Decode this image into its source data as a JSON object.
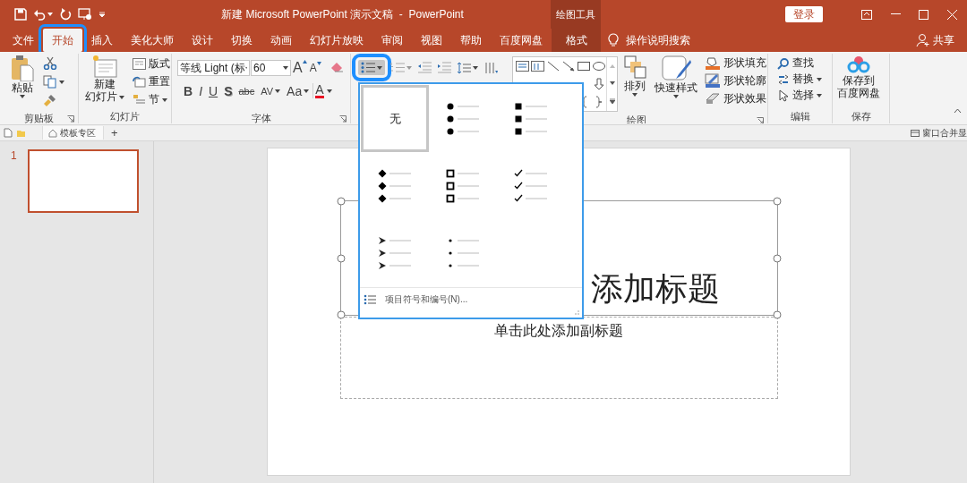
{
  "window": {
    "title": "新建 Microsoft PowerPoint 演示文稿  -  PowerPoint",
    "context_header": "绘图工具",
    "login": "登录"
  },
  "tabs": [
    {
      "label": "文件",
      "selected": false,
      "highlighted": false,
      "kind": "normal"
    },
    {
      "label": "开始",
      "selected": true,
      "highlighted": true,
      "kind": "normal"
    },
    {
      "label": "插入",
      "selected": false,
      "highlighted": false,
      "kind": "normal"
    },
    {
      "label": "美化大师",
      "selected": false,
      "highlighted": false,
      "kind": "normal"
    },
    {
      "label": "设计",
      "selected": false,
      "highlighted": false,
      "kind": "normal"
    },
    {
      "label": "切换",
      "selected": false,
      "highlighted": false,
      "kind": "normal"
    },
    {
      "label": "动画",
      "selected": false,
      "highlighted": false,
      "kind": "normal"
    },
    {
      "label": "幻灯片放映",
      "selected": false,
      "highlighted": false,
      "kind": "normal"
    },
    {
      "label": "审阅",
      "selected": false,
      "highlighted": false,
      "kind": "normal"
    },
    {
      "label": "视图",
      "selected": false,
      "highlighted": false,
      "kind": "normal"
    },
    {
      "label": "帮助",
      "selected": false,
      "highlighted": false,
      "kind": "normal"
    },
    {
      "label": "百度网盘",
      "selected": false,
      "highlighted": false,
      "kind": "normal"
    },
    {
      "label": "格式",
      "selected": false,
      "highlighted": false,
      "kind": "contextual"
    }
  ],
  "tell_me": "操作说明搜索",
  "share": "共享",
  "ribbon": {
    "clipboard": {
      "paste": "粘贴",
      "label": "剪贴板"
    },
    "slides": {
      "new_slide": [
        "新建",
        "幻灯片"
      ],
      "layout": "版式",
      "reset": "重置",
      "section": "节",
      "label": "幻灯片"
    },
    "font": {
      "name": "等线 Light (标",
      "size": "60",
      "grow": "A",
      "shrink": "A",
      "color_button": "A",
      "label": "字体",
      "format_buttons": [
        {
          "label": "B",
          "kind": "bold",
          "menu": false
        },
        {
          "label": "I",
          "kind": "italic",
          "menu": false
        },
        {
          "label": "U",
          "kind": "underline",
          "menu": false
        },
        {
          "label": "S",
          "kind": "shadow",
          "menu": false
        },
        {
          "label": "abc",
          "kind": "strike",
          "menu": false
        },
        {
          "label": "AV",
          "kind": "spacing",
          "menu": true
        },
        {
          "label": "Aa",
          "kind": "case",
          "menu": true
        }
      ]
    },
    "paragraph": {
      "bullets": {
        "pressed": true,
        "highlighted": true
      }
    },
    "drawing": {
      "arrange": "排列",
      "quick_styles": "快速样式",
      "label": "绘图",
      "shape_buttons": [
        {
          "label": "形状填充",
          "kind": "fill"
        },
        {
          "label": "形状轮廓",
          "kind": "outline"
        },
        {
          "label": "形状效果",
          "kind": "effects"
        }
      ]
    },
    "editing": {
      "label": "编辑",
      "buttons": [
        {
          "label": "查找",
          "kind": "find",
          "menu": false
        },
        {
          "label": "替换",
          "kind": "replace",
          "menu": true
        },
        {
          "label": "选择",
          "kind": "select",
          "menu": true
        }
      ]
    },
    "save": {
      "lines": [
        "保存到",
        "百度网盘"
      ],
      "label": "保存"
    }
  },
  "template_bar": {
    "tab": "模板专区",
    "add": "+",
    "merge": "窗口合并显"
  },
  "slide_panel": {
    "slides": [
      {
        "number": "1",
        "selected": true
      }
    ]
  },
  "slide": {
    "title": "添加标题",
    "subtitle": "单击此处添加副标题",
    "title_selected": true
  },
  "bullet_menu": {
    "footer": "项目符号和编号(N)...",
    "options": [
      {
        "kind": "none",
        "label": "无",
        "selected": true
      },
      {
        "kind": "round",
        "selected": false
      },
      {
        "kind": "square",
        "selected": false
      },
      {
        "kind": "diamond",
        "selected": false
      },
      {
        "kind": "hollow-square",
        "selected": false
      },
      {
        "kind": "check",
        "selected": false
      },
      {
        "kind": "arrow",
        "selected": false
      },
      {
        "kind": "dot",
        "selected": false
      }
    ]
  }
}
